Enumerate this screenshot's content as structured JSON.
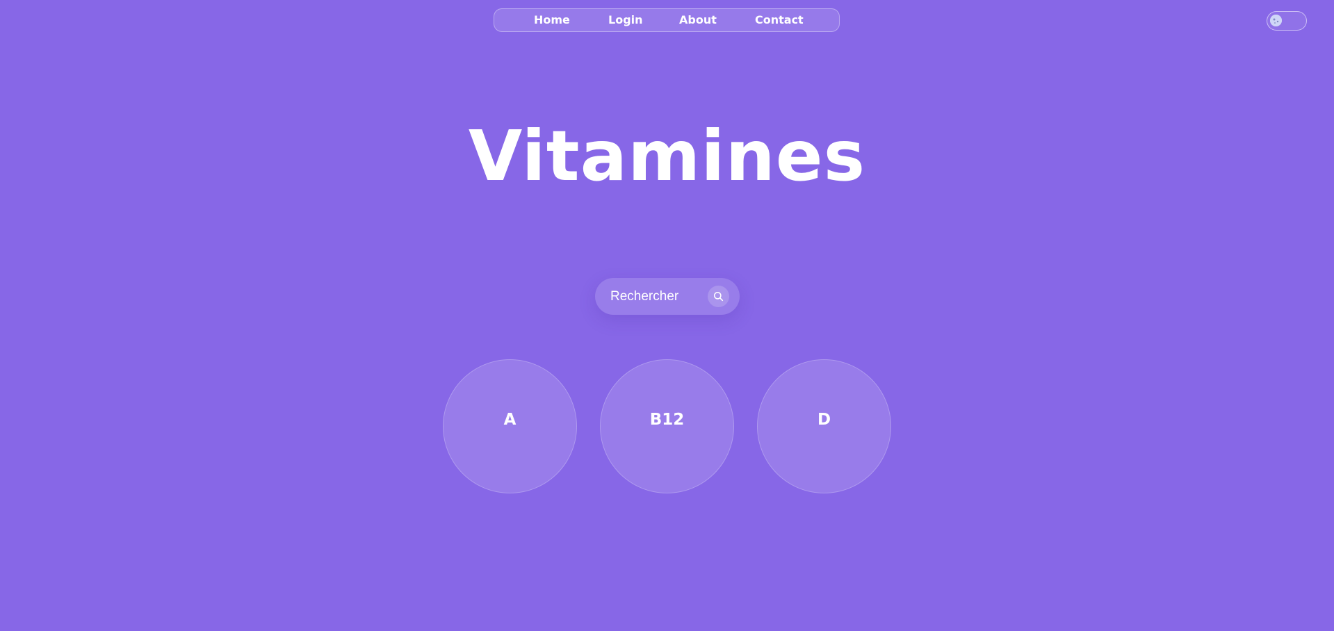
{
  "nav": {
    "items": [
      {
        "label": "Home"
      },
      {
        "label": "Login"
      },
      {
        "label": "About"
      },
      {
        "label": "Contact"
      }
    ]
  },
  "theme_toggle": {
    "icon": "moon-face-icon",
    "state": "off"
  },
  "hero": {
    "title": "Vitamines"
  },
  "search": {
    "placeholder": "Rechercher",
    "value": "",
    "icon": "search-icon"
  },
  "vitamins": [
    {
      "label": "A"
    },
    {
      "label": "B12"
    },
    {
      "label": "D"
    }
  ],
  "colors": {
    "background": "#8767e7",
    "text": "#ffffff"
  }
}
